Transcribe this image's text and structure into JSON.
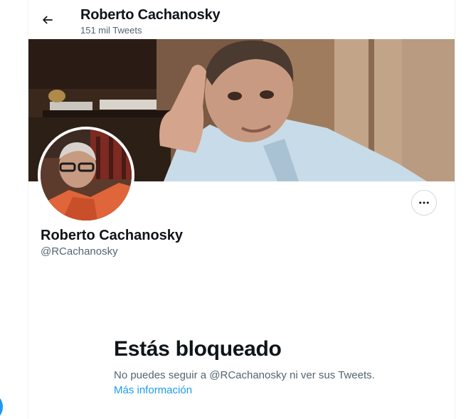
{
  "header": {
    "back_icon": "arrow-left-icon",
    "title": "Roberto Cachanosky",
    "tweet_count": "151 mil Tweets"
  },
  "profile": {
    "name": "Roberto Cachanosky",
    "handle": "@RCachanosky",
    "more_icon": "more-horizontal-icon"
  },
  "blocked": {
    "title": "Estás bloqueado",
    "description": "No puedes seguir a @RCachanosky ni ver sus Tweets.",
    "link": "Más información"
  },
  "colors": {
    "accent": "#1d9bf0",
    "text_primary": "#0f1419",
    "text_secondary": "#536471",
    "border": "#cfd9de"
  }
}
